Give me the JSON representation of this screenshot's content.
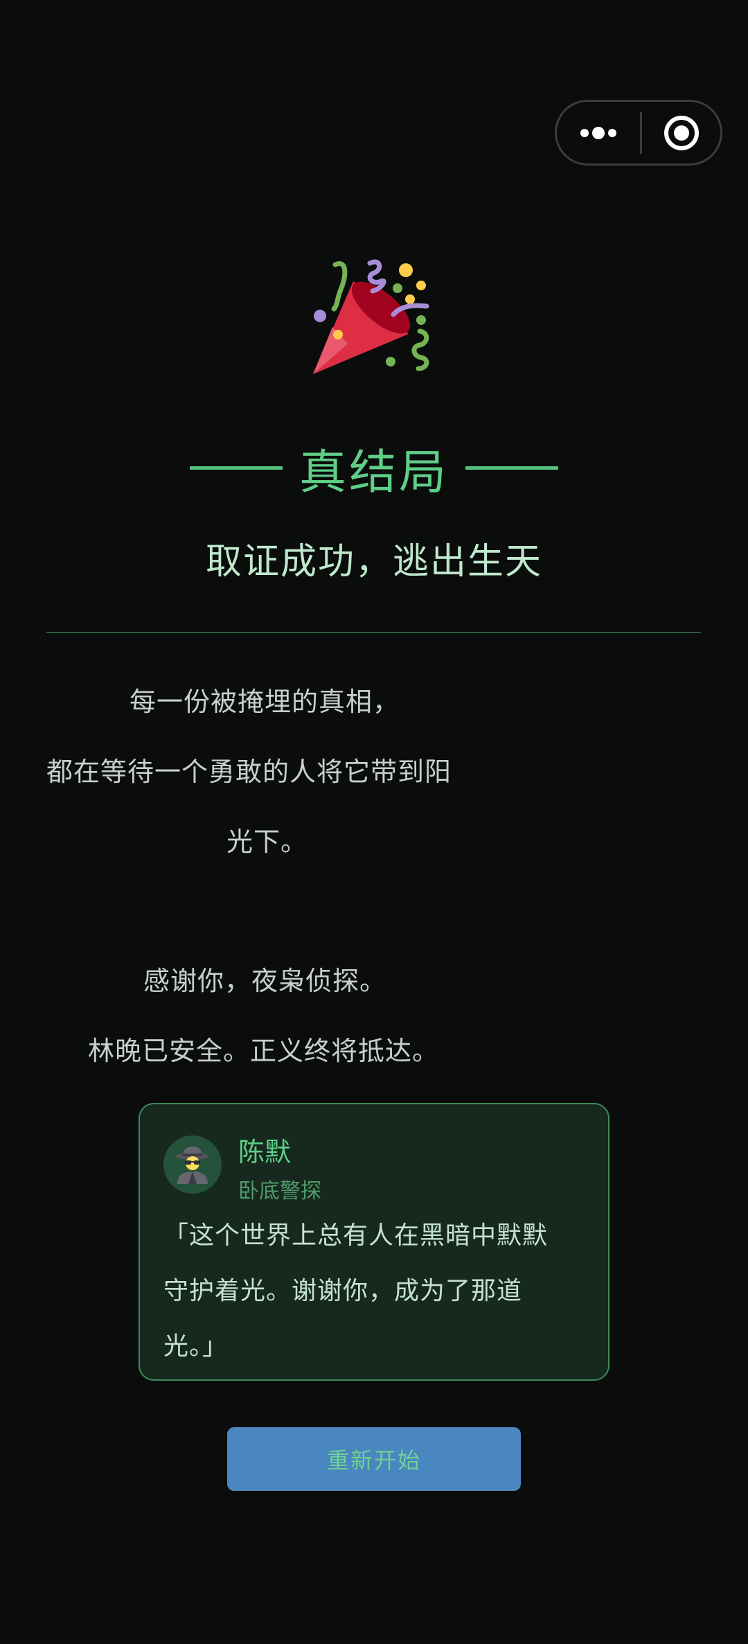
{
  "capsule": {
    "more_icon": "more-dots-icon",
    "close_icon": "target-circle-icon"
  },
  "hero": {
    "icon": "party-popper-icon"
  },
  "ending": {
    "title": "真结局",
    "subtitle": "取证成功，逃出生天"
  },
  "poem": {
    "line1": "每一份被掩埋的真相，",
    "line2": "都在等待一个勇敢的人将它带到阳",
    "line3": "光下。",
    "line4": "感谢你，夜枭侦探。",
    "line5": "林晚已安全。正义终将抵达。"
  },
  "quote_card": {
    "avatar_icon": "detective-icon",
    "name": "陈默",
    "role": "卧底警探",
    "quote": "「这个世界上总有人在黑暗中默默守护着光。谢谢你，成为了那道光。」"
  },
  "actions": {
    "restart_label": "重新开始"
  },
  "colors": {
    "background": "#0a0d0b",
    "accent_green": "#5fcf88",
    "button_blue": "#4a86bf",
    "card_bg": "#17281e"
  }
}
